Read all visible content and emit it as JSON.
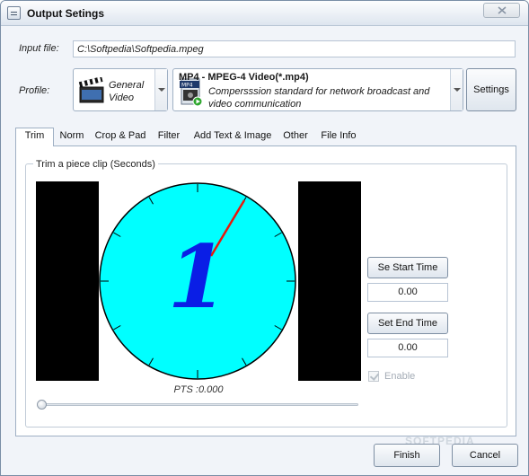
{
  "window": {
    "title": "Output Setings"
  },
  "input": {
    "label": "Input file:",
    "value": "C:\\Softpedia\\Softpedia.mpeg"
  },
  "profile": {
    "label": "Profile:",
    "category_line1": "General",
    "category_line2": "Video",
    "format_title": "MP4 - MPEG-4 Video(*.mp4)",
    "format_desc_line1": "Compersssion standard for network broadcast and",
    "format_desc_line2": "video communication",
    "settings_label": "Settings"
  },
  "tabs": [
    {
      "label": "Trim",
      "active": true
    },
    {
      "label": "Norm"
    },
    {
      "label": "Crop & Pad"
    },
    {
      "label": "Filter"
    },
    {
      "label": "Add Text & Image"
    },
    {
      "label": "Other"
    },
    {
      "label": "File Info"
    }
  ],
  "trim": {
    "group_title": "Trim a piece clip (Seconds)",
    "pts": "PTS :0.000",
    "start_button": "Se Start Time",
    "start_value": "0.00",
    "end_button": "Set End Time",
    "end_value": "0.00",
    "enable_label": "Enable",
    "enable_checked": true,
    "enable_disabled": true,
    "slider_position": 0,
    "preview_digit": "1",
    "colors": {
      "dial": "#00FFFF",
      "hand": "#E8180C",
      "digit": "#0A1EE6",
      "letterbox": "#000000"
    }
  },
  "footer": {
    "finish_label": "Finish",
    "cancel_label": "Cancel",
    "watermark": "SOFTPEDIA"
  }
}
